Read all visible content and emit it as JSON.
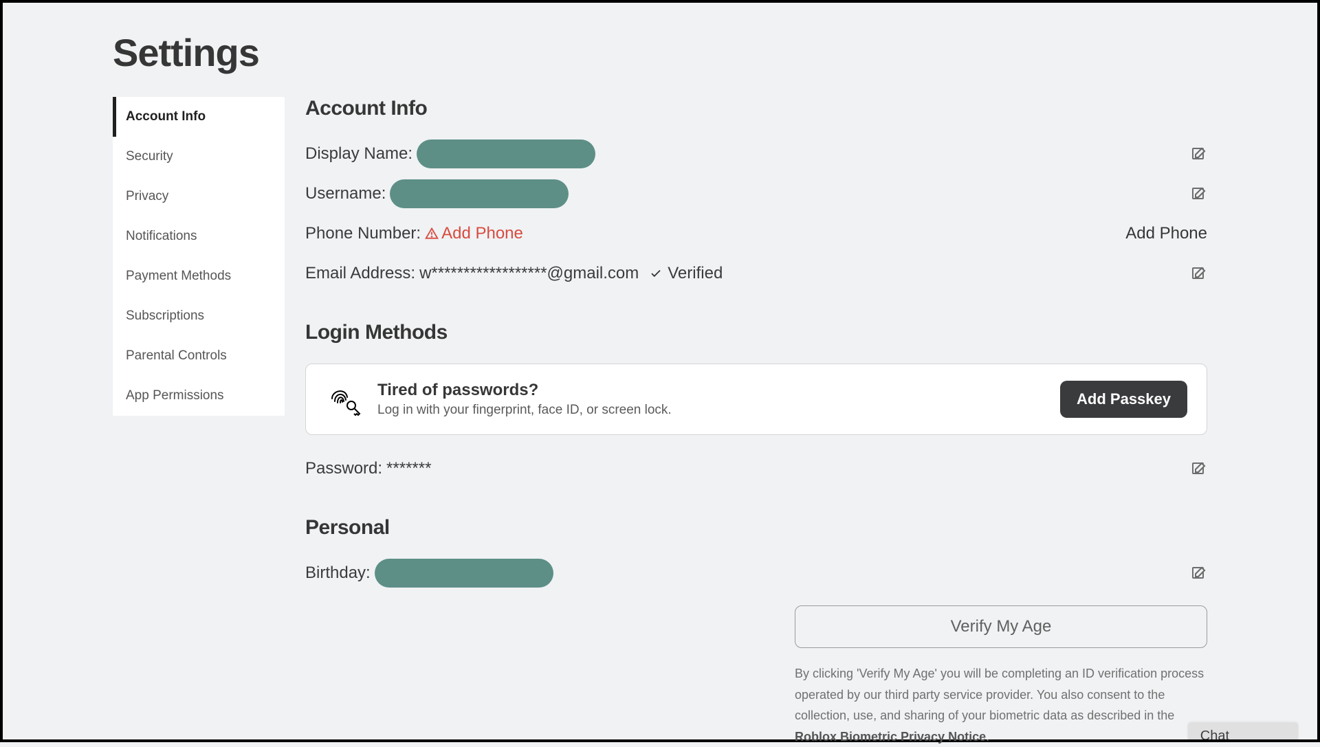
{
  "page": {
    "title": "Settings"
  },
  "sidebar": {
    "items": [
      {
        "label": "Account Info",
        "active": true
      },
      {
        "label": "Security",
        "active": false
      },
      {
        "label": "Privacy",
        "active": false
      },
      {
        "label": "Notifications",
        "active": false
      },
      {
        "label": "Payment Methods",
        "active": false
      },
      {
        "label": "Subscriptions",
        "active": false
      },
      {
        "label": "Parental Controls",
        "active": false
      },
      {
        "label": "App Permissions",
        "active": false
      }
    ]
  },
  "account_info": {
    "heading": "Account Info",
    "display_name_label": "Display Name:",
    "username_label": "Username:",
    "phone_label": "Phone Number:",
    "add_phone_inline": "Add Phone",
    "add_phone_right": "Add Phone",
    "email_label": "Email Address:",
    "email_value": "w******************@gmail.com",
    "verified_label": "Verified"
  },
  "login_methods": {
    "heading": "Login Methods",
    "card_title": "Tired of passwords?",
    "card_sub": "Log in with your fingerprint, face ID, or screen lock.",
    "add_passkey_label": "Add Passkey",
    "password_label": "Password:",
    "password_value": "*******"
  },
  "personal": {
    "heading": "Personal",
    "birthday_label": "Birthday:",
    "verify_btn": "Verify My Age",
    "legal_prefix": "By clicking 'Verify My Age' you will be completing an ID verification process operated by our third party service provider. You also consent to the collection, use, and sharing of your biometric data as described in the ",
    "legal_link": "Roblox Biometric Privacy Notice",
    "legal_suffix": "."
  },
  "chat": {
    "label": "Chat"
  },
  "colors": {
    "redaction_pill": "#5d8f87",
    "danger": "#d84b3f",
    "button_dark": "#393b3d"
  }
}
